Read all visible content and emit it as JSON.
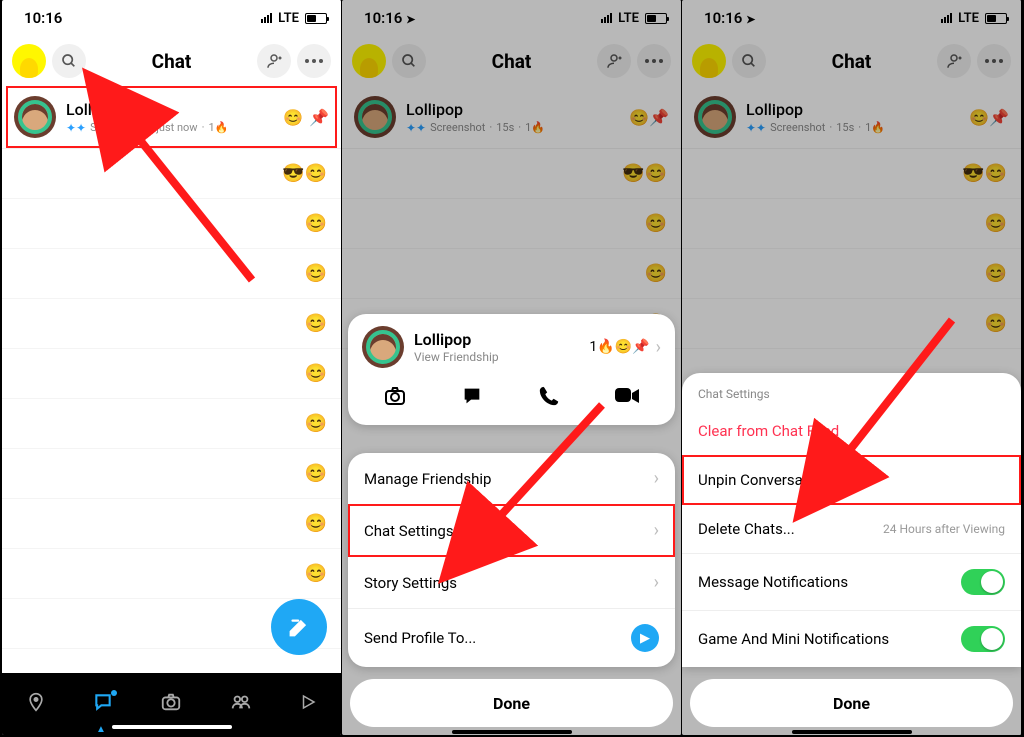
{
  "statusbar": {
    "time": "10:16",
    "net": "LTE"
  },
  "header": {
    "title": "Chat"
  },
  "chat": {
    "name": "Lollipop",
    "status": "Screenshot",
    "time1": "just now",
    "time2": "15s",
    "streak": "1🔥"
  },
  "sheet_profile": {
    "name": "Lollipop",
    "sub": "View Friendship",
    "badge": "1🔥😊📌"
  },
  "sheet_menu": {
    "manage": "Manage Friendship",
    "chat_settings": "Chat Settings",
    "story": "Story Settings",
    "send": "Send Profile To..."
  },
  "settings": {
    "title": "Chat Settings",
    "clear": "Clear from Chat Feed",
    "unpin": "Unpin Conversation",
    "delete": "Delete Chats...",
    "delete_sub": "24 Hours after Viewing",
    "msg_notif": "Message Notifications",
    "game_notif": "Game And Mini Notifications"
  },
  "done": "Done"
}
